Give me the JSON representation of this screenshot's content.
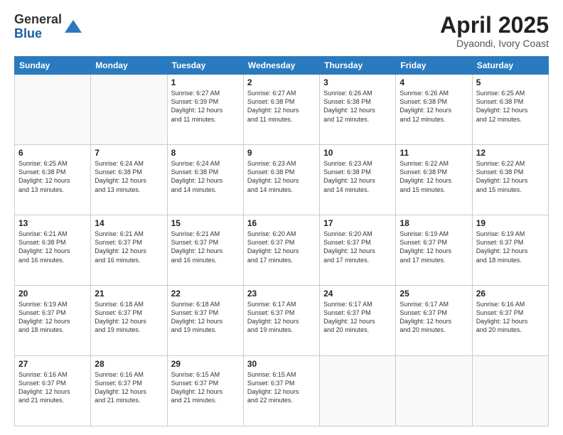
{
  "logo": {
    "general": "General",
    "blue": "Blue"
  },
  "title": {
    "month": "April 2025",
    "location": "Dyaondi, Ivory Coast"
  },
  "weekdays": [
    "Sunday",
    "Monday",
    "Tuesday",
    "Wednesday",
    "Thursday",
    "Friday",
    "Saturday"
  ],
  "weeks": [
    [
      {
        "day": "",
        "detail": ""
      },
      {
        "day": "",
        "detail": ""
      },
      {
        "day": "1",
        "detail": "Sunrise: 6:27 AM\nSunset: 6:39 PM\nDaylight: 12 hours\nand 11 minutes."
      },
      {
        "day": "2",
        "detail": "Sunrise: 6:27 AM\nSunset: 6:38 PM\nDaylight: 12 hours\nand 11 minutes."
      },
      {
        "day": "3",
        "detail": "Sunrise: 6:26 AM\nSunset: 6:38 PM\nDaylight: 12 hours\nand 12 minutes."
      },
      {
        "day": "4",
        "detail": "Sunrise: 6:26 AM\nSunset: 6:38 PM\nDaylight: 12 hours\nand 12 minutes."
      },
      {
        "day": "5",
        "detail": "Sunrise: 6:25 AM\nSunset: 6:38 PM\nDaylight: 12 hours\nand 12 minutes."
      }
    ],
    [
      {
        "day": "6",
        "detail": "Sunrise: 6:25 AM\nSunset: 6:38 PM\nDaylight: 12 hours\nand 13 minutes."
      },
      {
        "day": "7",
        "detail": "Sunrise: 6:24 AM\nSunset: 6:38 PM\nDaylight: 12 hours\nand 13 minutes."
      },
      {
        "day": "8",
        "detail": "Sunrise: 6:24 AM\nSunset: 6:38 PM\nDaylight: 12 hours\nand 14 minutes."
      },
      {
        "day": "9",
        "detail": "Sunrise: 6:23 AM\nSunset: 6:38 PM\nDaylight: 12 hours\nand 14 minutes."
      },
      {
        "day": "10",
        "detail": "Sunrise: 6:23 AM\nSunset: 6:38 PM\nDaylight: 12 hours\nand 14 minutes."
      },
      {
        "day": "11",
        "detail": "Sunrise: 6:22 AM\nSunset: 6:38 PM\nDaylight: 12 hours\nand 15 minutes."
      },
      {
        "day": "12",
        "detail": "Sunrise: 6:22 AM\nSunset: 6:38 PM\nDaylight: 12 hours\nand 15 minutes."
      }
    ],
    [
      {
        "day": "13",
        "detail": "Sunrise: 6:21 AM\nSunset: 6:38 PM\nDaylight: 12 hours\nand 16 minutes."
      },
      {
        "day": "14",
        "detail": "Sunrise: 6:21 AM\nSunset: 6:37 PM\nDaylight: 12 hours\nand 16 minutes."
      },
      {
        "day": "15",
        "detail": "Sunrise: 6:21 AM\nSunset: 6:37 PM\nDaylight: 12 hours\nand 16 minutes."
      },
      {
        "day": "16",
        "detail": "Sunrise: 6:20 AM\nSunset: 6:37 PM\nDaylight: 12 hours\nand 17 minutes."
      },
      {
        "day": "17",
        "detail": "Sunrise: 6:20 AM\nSunset: 6:37 PM\nDaylight: 12 hours\nand 17 minutes."
      },
      {
        "day": "18",
        "detail": "Sunrise: 6:19 AM\nSunset: 6:37 PM\nDaylight: 12 hours\nand 17 minutes."
      },
      {
        "day": "19",
        "detail": "Sunrise: 6:19 AM\nSunset: 6:37 PM\nDaylight: 12 hours\nand 18 minutes."
      }
    ],
    [
      {
        "day": "20",
        "detail": "Sunrise: 6:19 AM\nSunset: 6:37 PM\nDaylight: 12 hours\nand 18 minutes."
      },
      {
        "day": "21",
        "detail": "Sunrise: 6:18 AM\nSunset: 6:37 PM\nDaylight: 12 hours\nand 19 minutes."
      },
      {
        "day": "22",
        "detail": "Sunrise: 6:18 AM\nSunset: 6:37 PM\nDaylight: 12 hours\nand 19 minutes."
      },
      {
        "day": "23",
        "detail": "Sunrise: 6:17 AM\nSunset: 6:37 PM\nDaylight: 12 hours\nand 19 minutes."
      },
      {
        "day": "24",
        "detail": "Sunrise: 6:17 AM\nSunset: 6:37 PM\nDaylight: 12 hours\nand 20 minutes."
      },
      {
        "day": "25",
        "detail": "Sunrise: 6:17 AM\nSunset: 6:37 PM\nDaylight: 12 hours\nand 20 minutes."
      },
      {
        "day": "26",
        "detail": "Sunrise: 6:16 AM\nSunset: 6:37 PM\nDaylight: 12 hours\nand 20 minutes."
      }
    ],
    [
      {
        "day": "27",
        "detail": "Sunrise: 6:16 AM\nSunset: 6:37 PM\nDaylight: 12 hours\nand 21 minutes."
      },
      {
        "day": "28",
        "detail": "Sunrise: 6:16 AM\nSunset: 6:37 PM\nDaylight: 12 hours\nand 21 minutes."
      },
      {
        "day": "29",
        "detail": "Sunrise: 6:15 AM\nSunset: 6:37 PM\nDaylight: 12 hours\nand 21 minutes."
      },
      {
        "day": "30",
        "detail": "Sunrise: 6:15 AM\nSunset: 6:37 PM\nDaylight: 12 hours\nand 22 minutes."
      },
      {
        "day": "",
        "detail": ""
      },
      {
        "day": "",
        "detail": ""
      },
      {
        "day": "",
        "detail": ""
      }
    ]
  ]
}
